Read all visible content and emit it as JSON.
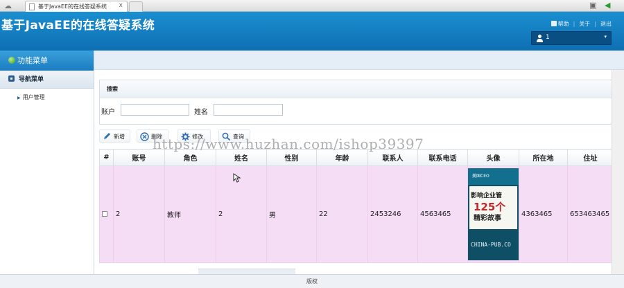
{
  "browser": {
    "tab_title": "基于JavaEE的在线答疑系统",
    "tab_close": "x"
  },
  "header": {
    "app_title": "基于JavaEE的在线答疑系统",
    "links": {
      "help": "帮助",
      "about": "关于",
      "logout": "退出"
    },
    "user": {
      "name": "1"
    }
  },
  "sidebar": {
    "title": "功能菜单",
    "nav_head": "导航菜单",
    "items": [
      {
        "label": "用户管理"
      }
    ]
  },
  "search": {
    "title": "搜索",
    "account_label": "账户",
    "account_value": "",
    "name_label": "姓名",
    "name_value": ""
  },
  "toolbar": {
    "add": "新增",
    "delete": "删除",
    "edit": "修改",
    "query": "查询"
  },
  "table": {
    "columns": [
      "#",
      "账号",
      "角色",
      "姓名",
      "性别",
      "年龄",
      "联系人",
      "联系电话",
      "头像",
      "所在地",
      "住址"
    ],
    "rows": [
      {
        "account": "2",
        "role": "教师",
        "name": "2",
        "gender": "男",
        "age": "22",
        "contact": "2453246",
        "phone": "4563465",
        "avatar_text": {
          "publisher": "美国CEO",
          "line1": "影响企业管",
          "line2": "125个",
          "line3": "精彩故事",
          "line4": "CHINA-PUB.CO"
        },
        "location": "4363465",
        "address": "653463465"
      }
    ]
  },
  "footer": {
    "text": "版权"
  },
  "watermark": "https://www.huzhan.com/ishop39397",
  "colors": {
    "header": "#1a8fd0",
    "row_bg": "#f5ddf5",
    "sidebar_head": "#3aa0dc"
  }
}
